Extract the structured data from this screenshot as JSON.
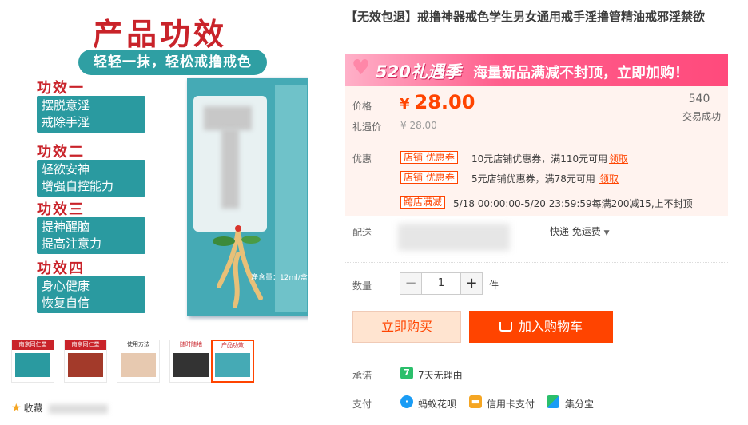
{
  "gallery": {
    "main_image": {
      "title": "产品功效",
      "slogan": "轻轻一抹，轻松戒撸戒色",
      "effects": [
        {
          "heading": "功效一",
          "lines": [
            "摆脱意淫",
            "戒除手淫"
          ]
        },
        {
          "heading": "功效二",
          "lines": [
            "轻欲安神",
            "增强自控能力"
          ]
        },
        {
          "heading": "功效三",
          "lines": [
            "提神醒脑",
            "提高注意力"
          ]
        },
        {
          "heading": "功效四",
          "lines": [
            "身心健康",
            "恢复自信"
          ]
        }
      ],
      "box_text": "净含量：12ml/盒"
    },
    "thumbnails": [
      {
        "caption": "南京同仁堂"
      },
      {
        "caption": "南京同仁堂"
      },
      {
        "caption": "使用方法"
      },
      {
        "caption": "随时随地"
      },
      {
        "caption": "产品功效"
      }
    ],
    "collect_label": "收藏"
  },
  "product": {
    "title": "【无效包退】戒撸神器戒色学生男女通用戒手淫撸管精油戒邪淫禁欲",
    "banner": {
      "event": "520礼遇季",
      "text": "海量新品满减不封顶，立即加购！"
    },
    "price_label": "价格",
    "price_currency": "¥",
    "price": "28.00",
    "orig_label": "礼遇价",
    "orig_price": "¥ 28.00",
    "sold_count": "540",
    "sold_label": "交易成功",
    "promo_label": "优惠",
    "coupons": [
      {
        "tag": "店铺  优惠券",
        "text": "10元店铺优惠券，满110元可用",
        "link": "领取"
      },
      {
        "tag": "店铺  优惠券",
        "text": "5元店铺优惠券，满78元可用",
        "link": "领取"
      }
    ],
    "cross_store": {
      "tag": "跨店满减",
      "text": "5/18 00:00:00-5/20 23:59:59每满200减15,上不封顶"
    },
    "shipping_label": "配送",
    "shipping_type": "快递 免运费",
    "qty_label": "数量",
    "qty_minus": "−",
    "qty_value": "1",
    "qty_plus": "+",
    "qty_unit": "件",
    "buy_now": "立即购买",
    "add_cart": "加入购物车",
    "promise_label": "承诺",
    "promise_icon": "7",
    "promise_text": "7天无理由",
    "pay_label": "支付",
    "payments": [
      "蚂蚁花呗",
      "信用卡支付",
      "集分宝"
    ]
  },
  "colors": {
    "accent": "#ff4400",
    "teal": "#2a9aa0",
    "red": "#c9232a",
    "banner": "#ff5f8d"
  }
}
